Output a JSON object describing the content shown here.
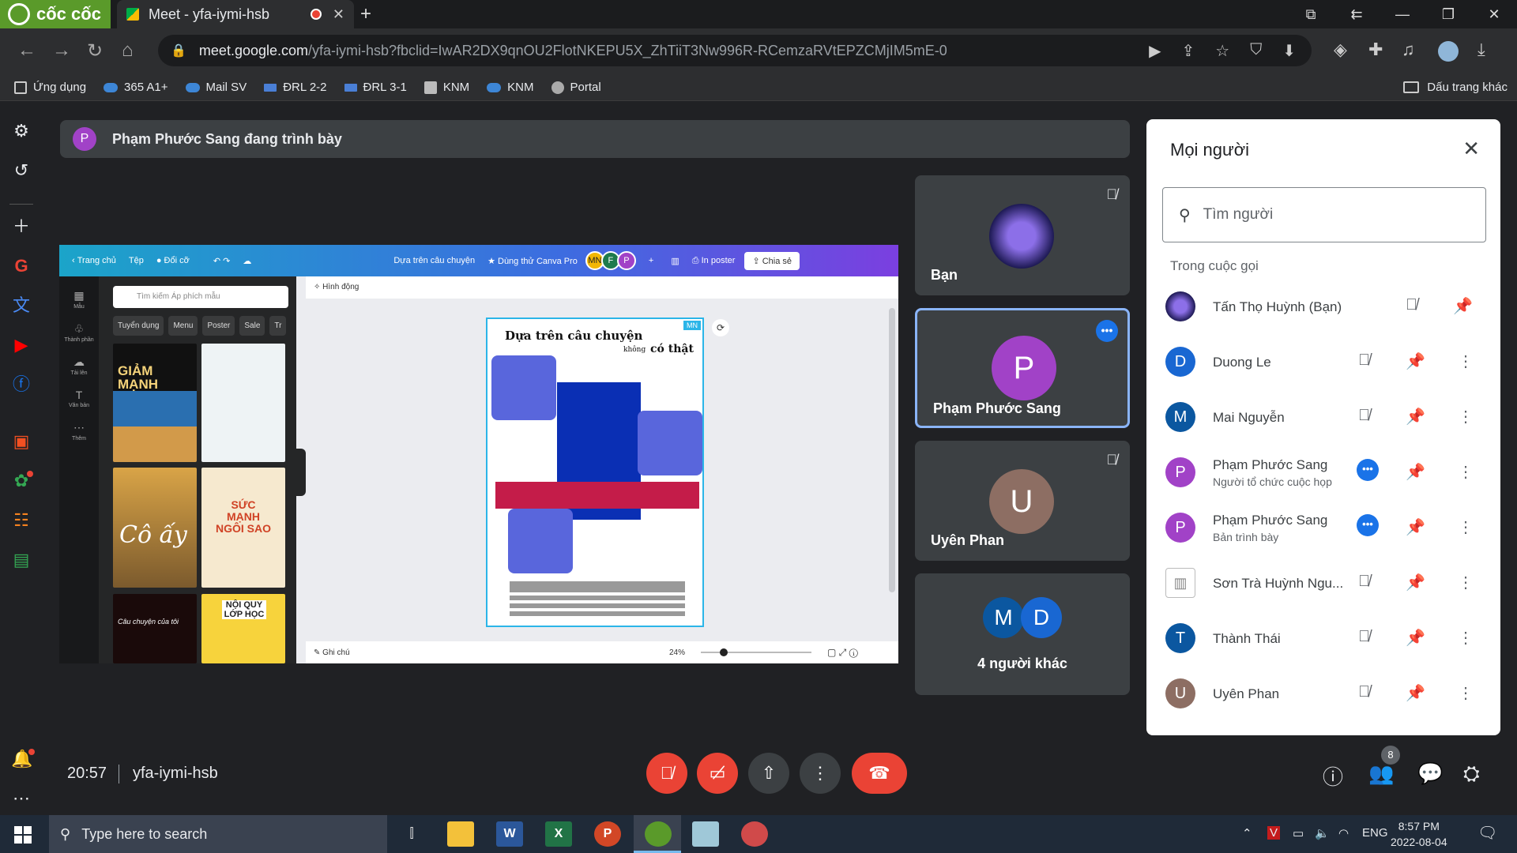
{
  "browser": {
    "brand": "cốc cốc",
    "tab_title": "Meet - yfa-iymi-hsb",
    "new_tab": "+",
    "url_host": "meet.google.com",
    "url_path": "/yfa-iymi-hsb?fbclid=IwAR2DX9qnOU2FlotNKEPU5X_ZhTiiT3Nw996R-RCemzaRVtEPZCMjIM5mE-0",
    "bookmarks": [
      "Ứng dụng",
      "365 A1+",
      "Mail SV",
      "ĐRL 2-2",
      "ĐRL 3-1",
      "KNM",
      "KNM",
      "Portal"
    ],
    "other_bookmarks": "Dấu trang khác"
  },
  "meet": {
    "presenting_avatar": "P",
    "presenting_text": "Phạm Phước Sang đang trình bày",
    "clock": "20:57",
    "meeting_code": "yfa-iymi-hsb",
    "participant_count": "8"
  },
  "canva": {
    "home": "Trang chủ",
    "file": "Tệp",
    "resize": "Đổi cỡ",
    "doc_title": "Dựa trên câu chuyện",
    "pro": "Dùng thử Canva Pro",
    "avatars": [
      "MN",
      "F",
      "P"
    ],
    "print": "In poster",
    "share": "Chia sẻ",
    "rail": [
      "Mẫu",
      "Thành phần",
      "Tải lên",
      "Văn bản",
      "Thêm"
    ],
    "search_placeholder": "Tìm kiếm Áp phích mẫu",
    "chips": [
      "Tuyển dụng",
      "Menu",
      "Poster",
      "Sale",
      "Tr"
    ],
    "animate": "Hình động",
    "notes": "Ghi chú",
    "zoom": "24%",
    "page_title": "Dựa trên câu chuyện",
    "page_sub_small": "không",
    "page_sub_big": "có thật",
    "page_badge": "MN",
    "thumb_texts": [
      "GIẢM MẠNH",
      "Cô ấy",
      "SỨC MẠNH NGÔI SAO",
      "NỘI QUY LỚP HỌC",
      "Câu chuyện của tôi"
    ]
  },
  "tiles": [
    {
      "name": "Bạn"
    },
    {
      "name": "Phạm Phước Sang",
      "initial": "P"
    },
    {
      "name": "Uyên Phan",
      "initial": "U"
    },
    {
      "name": "4 người khác",
      "initials": [
        "M",
        "D"
      ]
    }
  ],
  "people": {
    "title": "Mọi người",
    "search_placeholder": "Tìm người",
    "section": "Trong cuộc gọi",
    "list": [
      {
        "initial": "",
        "name": "Tấn Thọ Huỳnh (Bạn)",
        "sub": ""
      },
      {
        "initial": "D",
        "name": "Duong Le",
        "sub": ""
      },
      {
        "initial": "M",
        "name": "Mai Nguyễn",
        "sub": ""
      },
      {
        "initial": "P",
        "name": "Phạm Phước Sang",
        "sub": "Người tổ chức cuộc họp"
      },
      {
        "initial": "P",
        "name": "Phạm Phước Sang",
        "sub": "Bản trình bày"
      },
      {
        "initial": "",
        "name": "Sơn Trà Huỳnh Ngu...",
        "sub": ""
      },
      {
        "initial": "T",
        "name": "Thành Thái",
        "sub": ""
      },
      {
        "initial": "U",
        "name": "Uyên Phan",
        "sub": ""
      }
    ]
  },
  "taskbar": {
    "search": "Type here to search",
    "lang": "ENG",
    "time": "8:57 PM",
    "date": "2022-08-04"
  },
  "colors": {
    "meet_bg": "#202124",
    "tile_bg": "#3c4043",
    "accent_blue": "#1a73e8",
    "end_red": "#ea4335",
    "avatar_purple": "#a142c7"
  }
}
